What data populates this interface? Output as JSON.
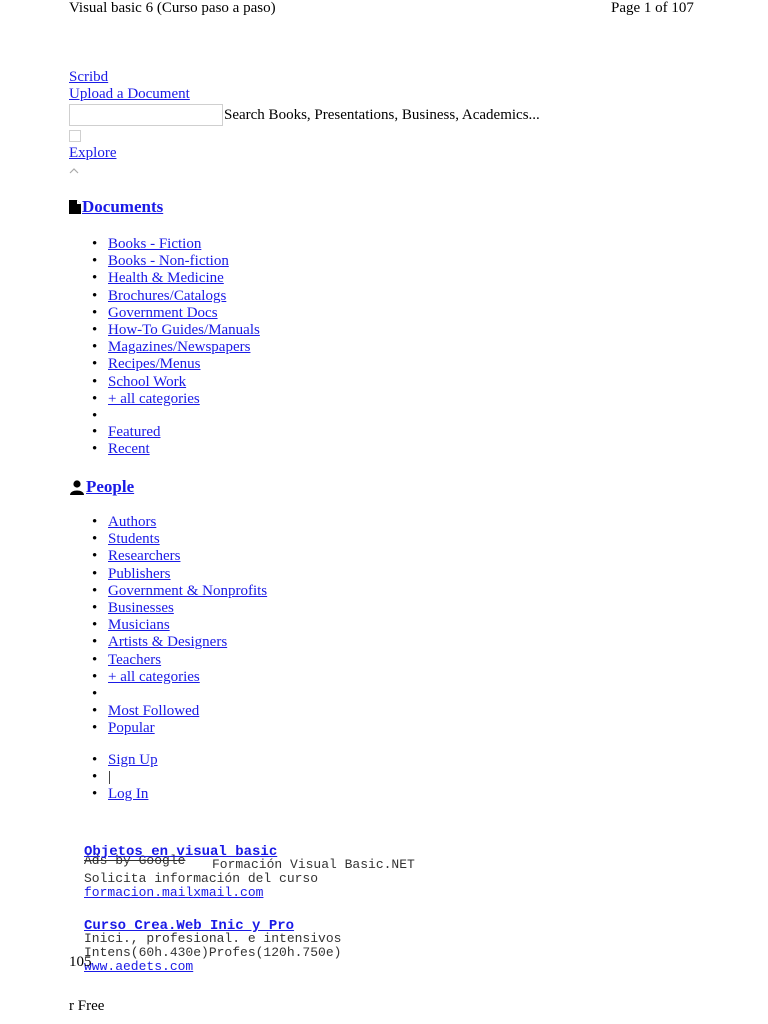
{
  "header": {
    "title": "Visual basic 6 (Curso paso a paso)",
    "page_info": "Page 1 of 107"
  },
  "nav": {
    "brand": "Scribd",
    "upload": "Upload a Document",
    "search_text": "Search Books, Presentations, Business, Academics...",
    "explore": "Explore"
  },
  "documents": {
    "title": "Documents",
    "items": [
      "Books - Fiction",
      "Books - Non-fiction",
      "Health & Medicine",
      "Brochures/Catalogs",
      "Government Docs",
      "How-To Guides/Manuals",
      "Magazines/Newspapers",
      "Recipes/Menus",
      "School Work",
      "+ all categories"
    ],
    "extra": [
      "Featured",
      "Recent"
    ]
  },
  "people": {
    "title": "People",
    "items": [
      "Authors",
      "Students",
      "Researchers",
      "Publishers",
      "Government & Nonprofits",
      "Businesses",
      "Musicians",
      "Artists & Designers",
      "Teachers",
      "+ all categories"
    ],
    "extra": [
      "Most Followed",
      "Popular"
    ]
  },
  "account": {
    "sign_up": "Sign Up",
    "separator": "|",
    "log_in": "Log In"
  },
  "ads": {
    "tag": "Ads by Google",
    "ad1": {
      "title": "Objetos en visual basic",
      "line1": "Formación Visual Basic.NET",
      "line2": "Solicita información del curso",
      "url": "formacion.mailxmail.com"
    },
    "ad2": {
      "title": "Curso Crea.Web Inic y Pro",
      "line1": "Inici., profesional. e intensivos",
      "line2": "Intens(60h.430e)Profes(120h.750e)",
      "url": "www.aedets.com"
    }
  },
  "page_number": "105",
  "footer": "r Free"
}
